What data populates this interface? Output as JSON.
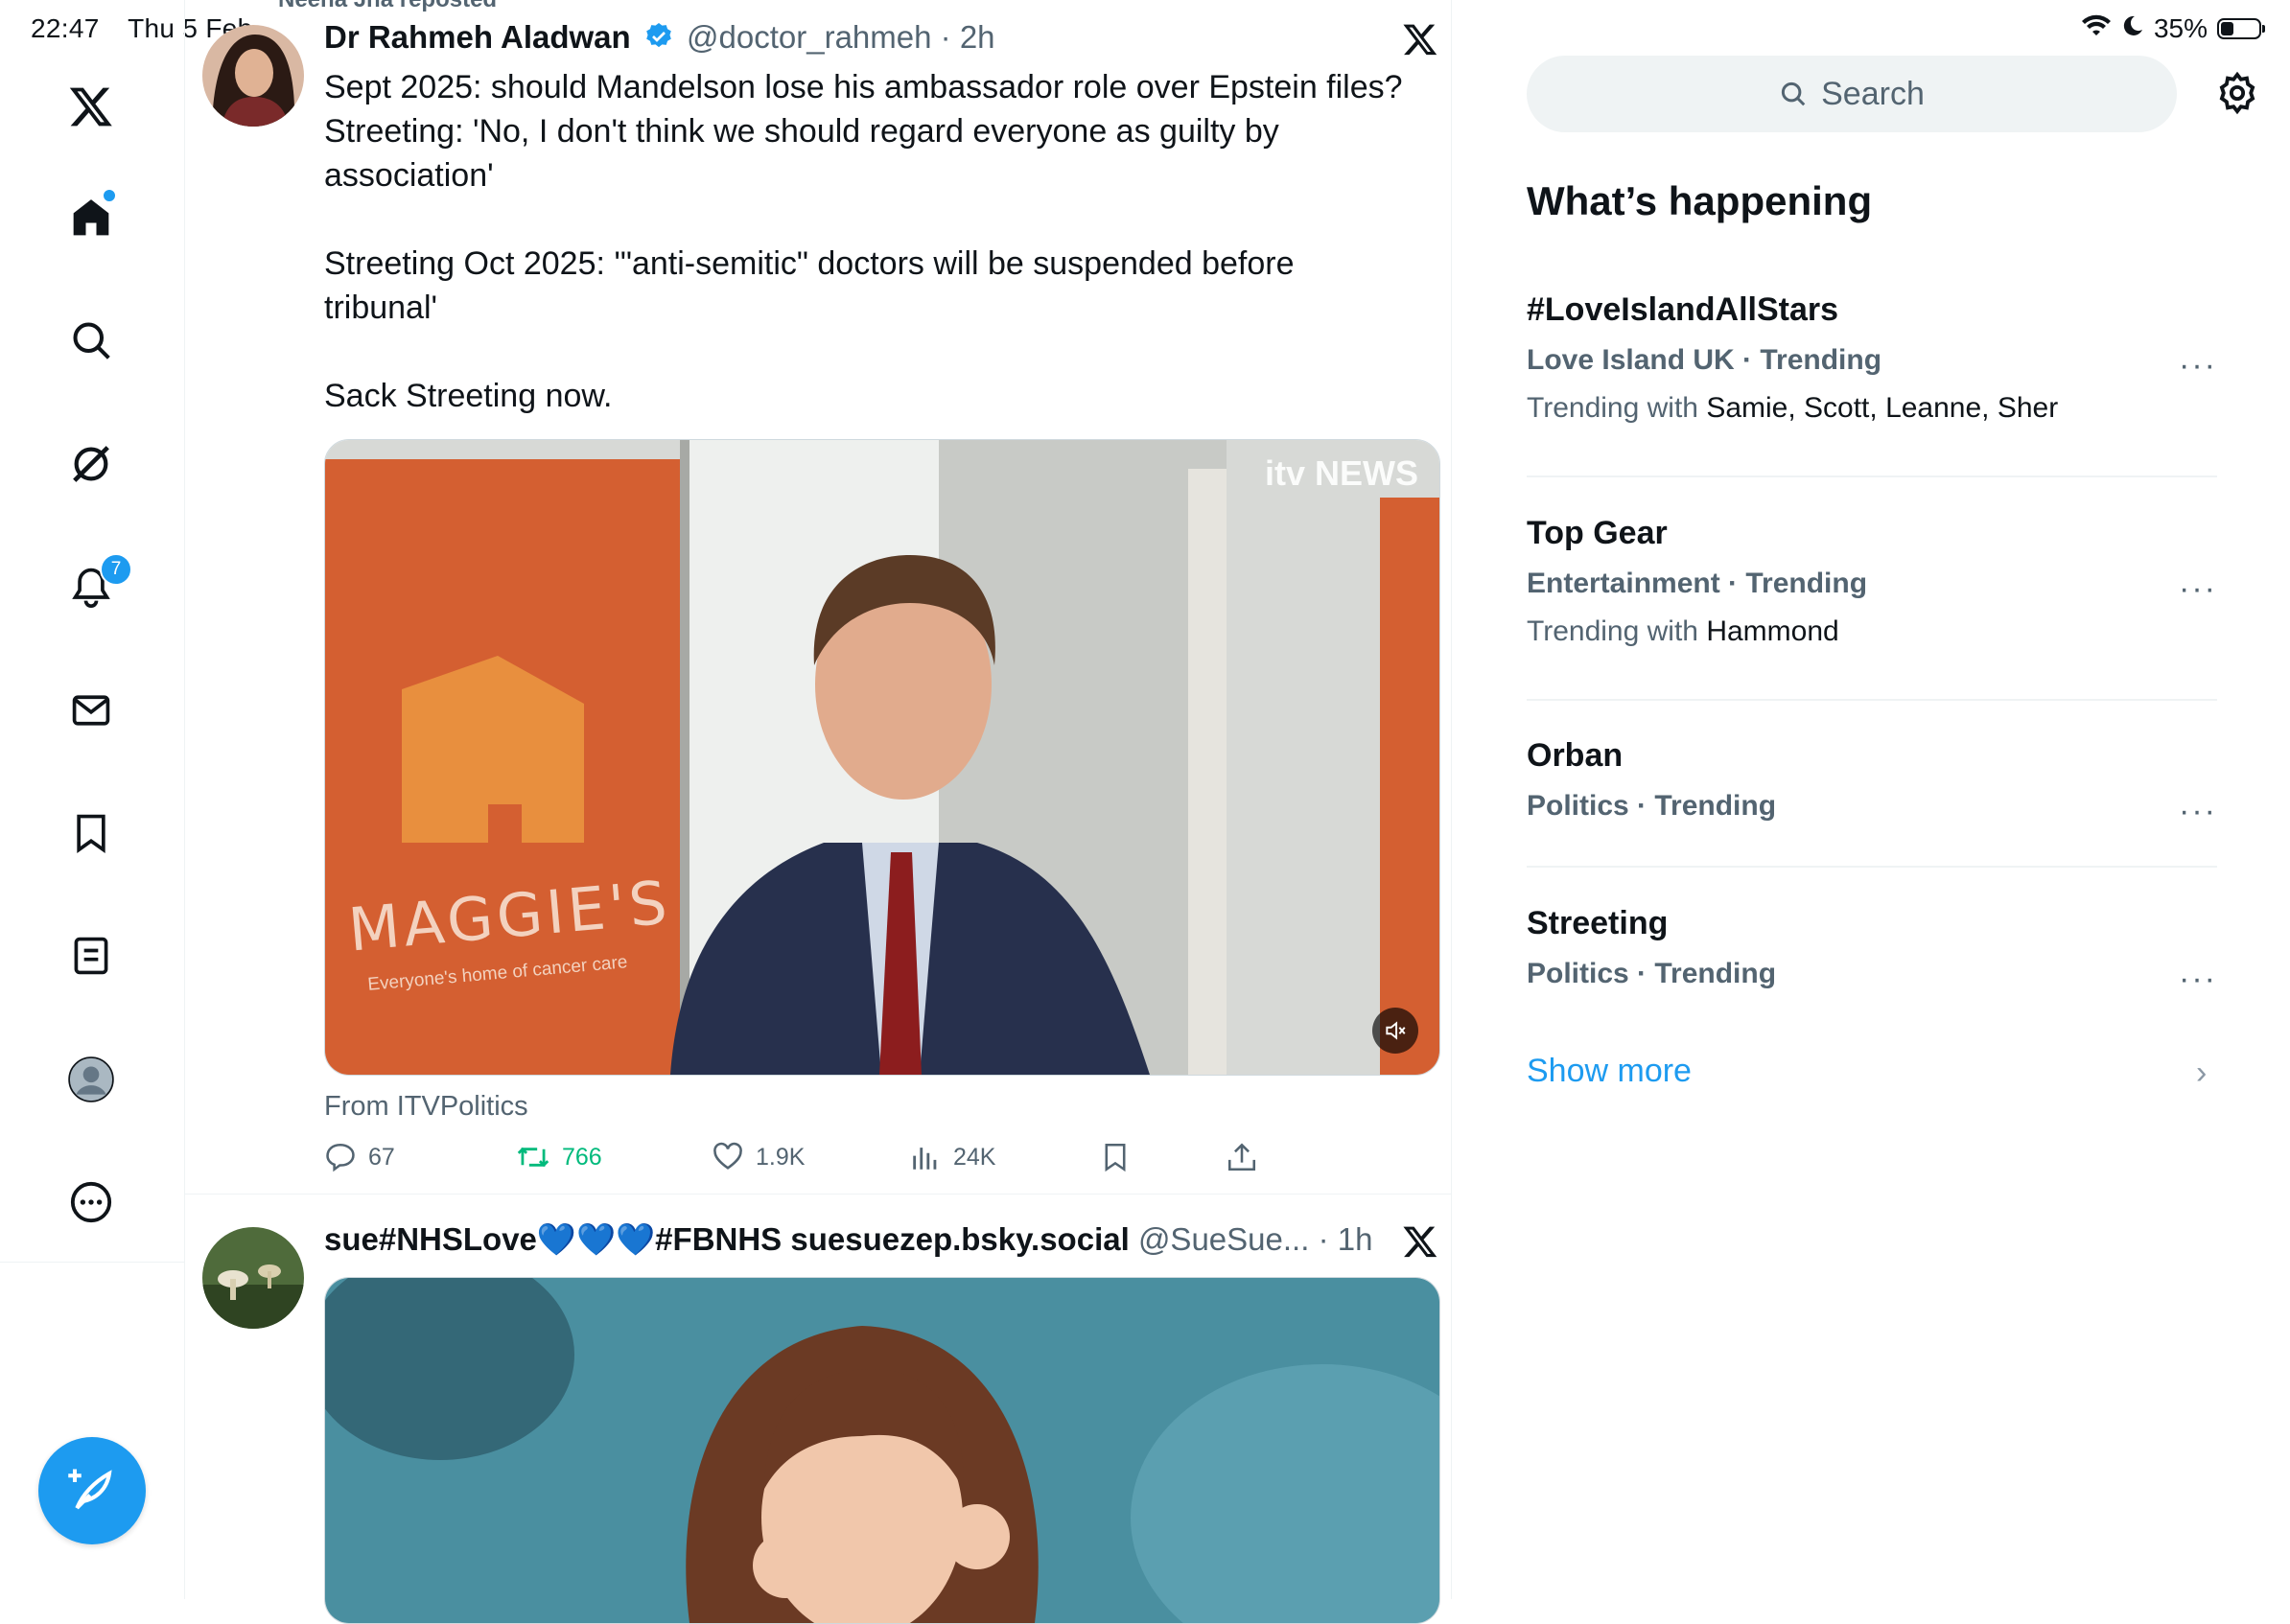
{
  "status_bar": {
    "time": "22:47",
    "date": "Thu 5 Feb",
    "battery": "35%",
    "battery_level": 0.35
  },
  "nav": {
    "items": [
      {
        "name": "x-logo-icon"
      },
      {
        "name": "home-icon"
      },
      {
        "name": "search-icon"
      },
      {
        "name": "grok-icon"
      },
      {
        "name": "notifications-icon",
        "badge": "7"
      },
      {
        "name": "messages-icon"
      },
      {
        "name": "bookmarks-icon"
      },
      {
        "name": "lists-icon"
      },
      {
        "name": "profile-icon"
      },
      {
        "name": "more-icon"
      }
    ]
  },
  "feed": {
    "repost_label": "Neena Jha reposted",
    "tweet1": {
      "name": "Dr Rahmeh Aladwan",
      "handle": "@doctor_rahmeh",
      "time": "2h",
      "text": "Sept 2025: should Mandelson lose his ambassador role over Epstein files?\nStreeting: 'No, I don't think we should regard everyone as guilty by\nassociation'\n\nStreeting Oct 2025: '\"anti-semitic\" doctors will be suspended before\ntribunal'\n\nSack Streeting now.",
      "media_watermark": "itv NEWS",
      "banner_text": "MAGGIE'S",
      "banner_subtext": "Everyone's home of cancer care",
      "from": "From ITVPolitics",
      "replies": "67",
      "reposts": "766",
      "likes": "1.9K",
      "views": "24K"
    },
    "tweet2": {
      "name": "sue#NHSLove💙💙💙#FBNHS suesuezep.bsky.social",
      "handle": "@SueSue...",
      "time": "1h"
    }
  },
  "right": {
    "search_placeholder": "Search",
    "section_title": "What’s happening",
    "trends": [
      {
        "title": "#LoveIslandAllStars",
        "meta": "Love Island UK · Trending",
        "with_label": "Trending with",
        "with": "Samie, Scott, Leanne, Sher"
      },
      {
        "title": "Top Gear",
        "meta": "Entertainment · Trending",
        "with_label": "Trending with",
        "with": "Hammond"
      },
      {
        "title": "Orban",
        "meta": "Politics · Trending"
      },
      {
        "title": "Streeting",
        "meta": "Politics · Trending"
      }
    ],
    "show_more": "Show more"
  },
  "colors": {
    "accent": "#1d9bf0",
    "repost_green": "#00ba7c",
    "muted": "#536471",
    "text": "#0f1419"
  }
}
